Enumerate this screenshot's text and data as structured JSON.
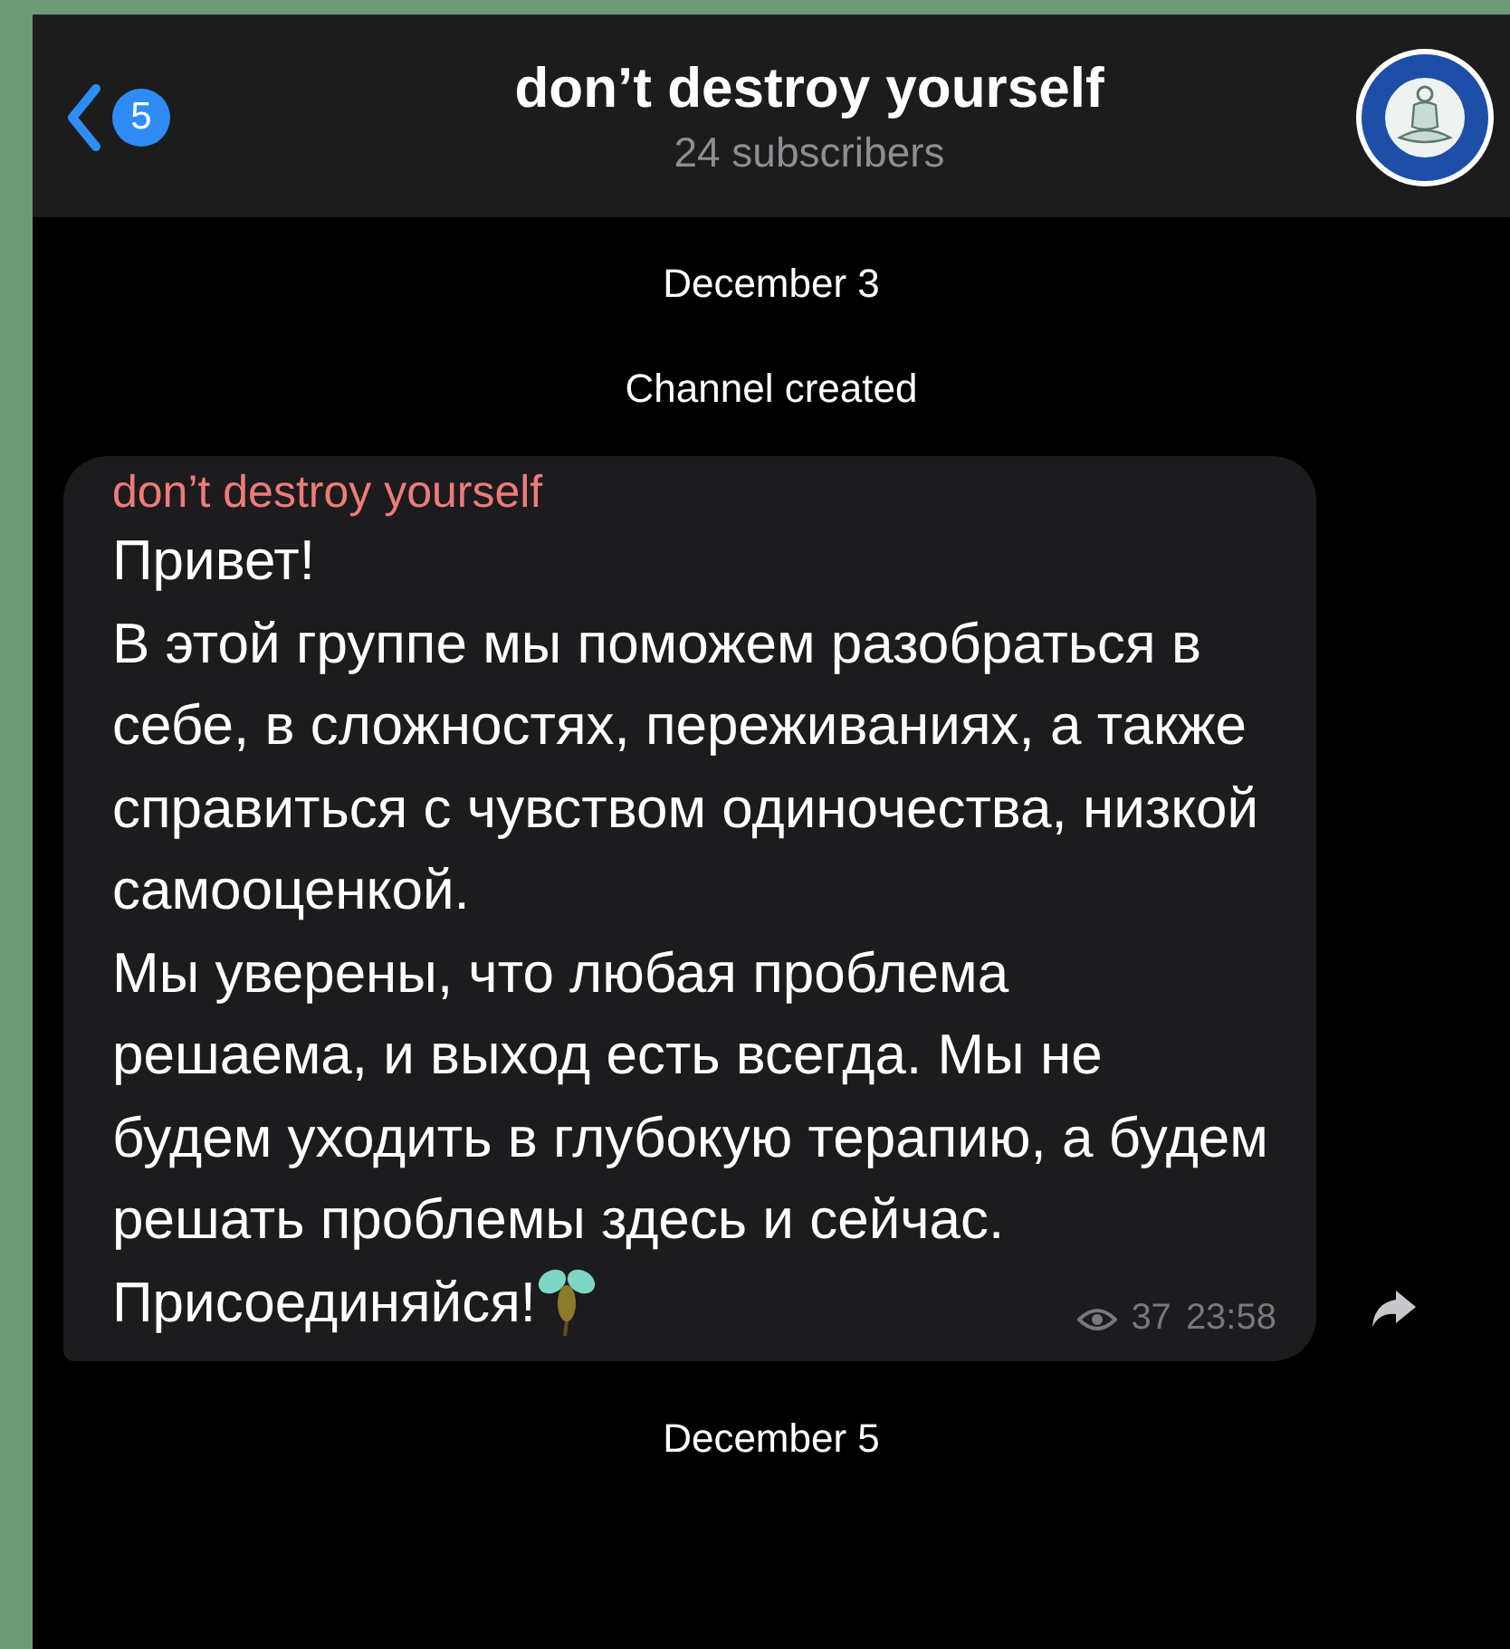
{
  "header": {
    "back_badge": "5",
    "title": "don’t destroy yourself",
    "subtitle": "24 subscribers"
  },
  "messages": [
    {
      "kind": "date",
      "text": "December 3"
    },
    {
      "kind": "service",
      "text": "Channel created"
    },
    {
      "kind": "post",
      "author": "don’t destroy yourself",
      "paragraphs": [
        "Привет!",
        "В этой группе мы поможем разобраться в себе, в сложностях, переживаниях, а также справиться с чувством одиночества, низкой самооценкой.",
        "Мы уверены, что любая проблема решаема, и выход есть всегда. Мы не будем уходить в глубокую терапию, а будем решать проблемы здесь и сейчас.",
        "Присоединяйся!"
      ],
      "views": "37",
      "time": "23:58"
    },
    {
      "kind": "date",
      "text": "December 5"
    }
  ]
}
